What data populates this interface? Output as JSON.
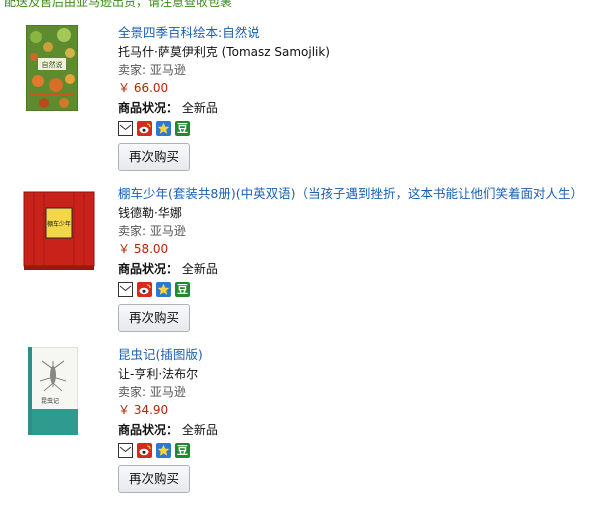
{
  "banner": {
    "text": "配送及售后由亚马逊出货，请注意查收包裹"
  },
  "ui": {
    "condition_label": "商品状况：",
    "buy_again_label": "再次购买"
  },
  "share_icons": [
    "mail-icon",
    "weibo-icon",
    "qzone-icon",
    "douban-icon"
  ],
  "douban_glyph": "豆",
  "colors": {
    "link": "#1a5fb4",
    "price": "#b12704",
    "weibo": "#d52b1e",
    "qzone": "#2a7ad4",
    "douban": "#1e8a2e"
  },
  "orders": [
    {
      "title": "全景四季百科绘本:自然说",
      "author": "托马什·萨莫伊利克 (Tomasz Samojlik)",
      "seller": "卖家: 亚马逊",
      "price": "￥ 66.00",
      "condition": "全新品",
      "cover_text": "自然说"
    },
    {
      "title": "棚车少年(套装共8册)(中英双语)（当孩子遇到挫折，这本书能让他们笑着面对人生）",
      "author": "钱德勒·华娜",
      "seller": "卖家: 亚马逊",
      "price": "￥ 58.00",
      "condition": "全新品",
      "cover_text": "棚车少年"
    },
    {
      "title": "昆虫记(插图版)",
      "author": "让-亨利·法布尔",
      "seller": "卖家: 亚马逊",
      "price": "￥ 34.90",
      "condition": "全新品",
      "cover_text": "昆虫记"
    }
  ]
}
